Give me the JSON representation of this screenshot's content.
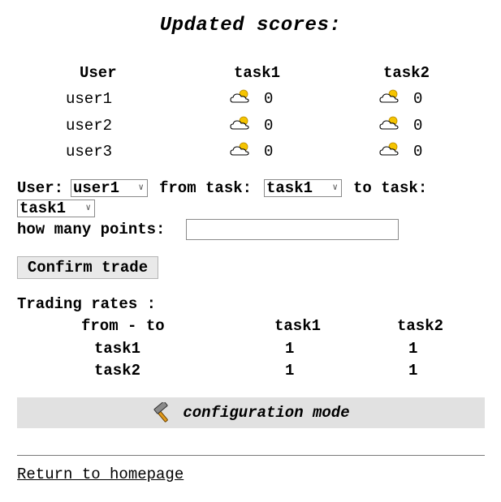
{
  "title": "Updated scores:",
  "scores": {
    "headers": [
      "User",
      "task1",
      "task2"
    ],
    "rows": [
      {
        "user": "user1",
        "task1": "0",
        "task2": "0"
      },
      {
        "user": "user2",
        "task1": "0",
        "task2": "0"
      },
      {
        "user": "user3",
        "task1": "0",
        "task2": "0"
      }
    ],
    "icon": "partly-sunny-icon"
  },
  "trade_form": {
    "user_label": "User:",
    "user_value": "user1",
    "from_label": "from task:",
    "from_value": "task1",
    "to_label": "to task:",
    "to_value": "task1",
    "points_label": "how many points:",
    "points_value": "",
    "confirm_label": "Confirm trade"
  },
  "rates": {
    "title": "Trading rates :",
    "corner": "from - to",
    "headers": [
      "task1",
      "task2"
    ],
    "rows": [
      {
        "from": "task1",
        "values": [
          "1",
          "1"
        ]
      },
      {
        "from": "task2",
        "values": [
          "1",
          "1"
        ]
      }
    ]
  },
  "config_label": "configuration mode",
  "config_icon": "hammer-icon",
  "homepage_link": "Return to homepage"
}
